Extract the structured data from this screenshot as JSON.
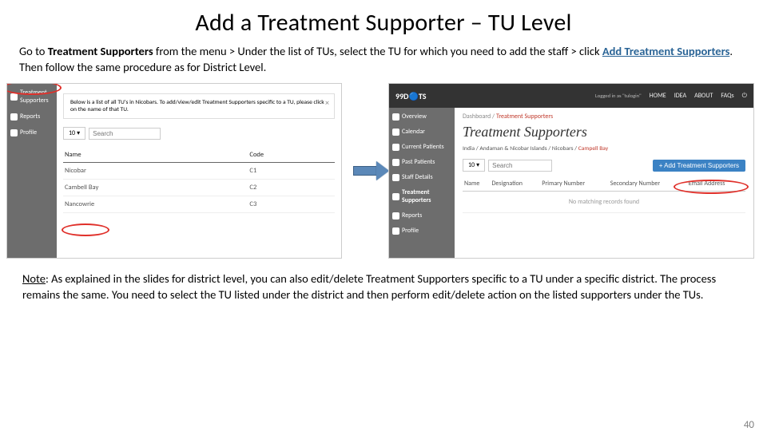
{
  "title": "Add a Treatment Supporter – TU Level",
  "instr": {
    "p1a": "Go to ",
    "p1b": "Treatment Supporters",
    "p1c": " from the menu > Under the list of TUs, select the TU for which you need to add the staff > click ",
    "p1d": "Add Treatment Supporters",
    "p1e": ". Then follow the same procedure as for District Level."
  },
  "shotL": {
    "sidebar": [
      "Treatment Supporters",
      "Reports",
      "Profile"
    ],
    "info": "Below is a list of all TU's in Nicobars. To add/view/edit Treatment Supporters specific to a TU, please click on the name of that TU.",
    "show": "10",
    "search": "Search",
    "cols": [
      "Name",
      "Code"
    ],
    "rows": [
      {
        "name": "Nicobar",
        "code": "C1"
      },
      {
        "name": "Cambell Bay",
        "code": "C2"
      },
      {
        "name": "Nancowrie",
        "code": "C3"
      }
    ]
  },
  "shotR": {
    "logo": "99D🔵TS",
    "loggedin": "Logged in as \"tulogin\"",
    "nav": [
      "HOME",
      "IDEA",
      "ABOUT",
      "FAQs"
    ],
    "sidebar": [
      "Overview",
      "Calendar",
      "Current Patients",
      "Past Patients",
      "Staff Details",
      "Treatment Supporters",
      "Reports",
      "Profile"
    ],
    "crumb1a": "Dashboard",
    "crumb1b": "Treatment Supporters",
    "heading": "Treatment Supporters",
    "crumb2": "India / Andaman & Nicobar Islands / Nicobars / ",
    "crumb2last": "Campell Bay",
    "show": "10",
    "search": "Search",
    "addbtn": "+ Add Treatment Supporters",
    "cols": [
      "Name",
      "Designation",
      "Primary Number",
      "Secondary Number",
      "Email Address"
    ],
    "norec": "No matching records found"
  },
  "note": {
    "lead": "Note",
    "body": ": As explained in the slides for district level, you can also edit/delete Treatment Supporters specific to a TU under a specific district. The process remains the same. You need to select the TU listed under the district and then perform edit/delete action on the listed supporters under the TUs."
  },
  "pagenum": "40"
}
